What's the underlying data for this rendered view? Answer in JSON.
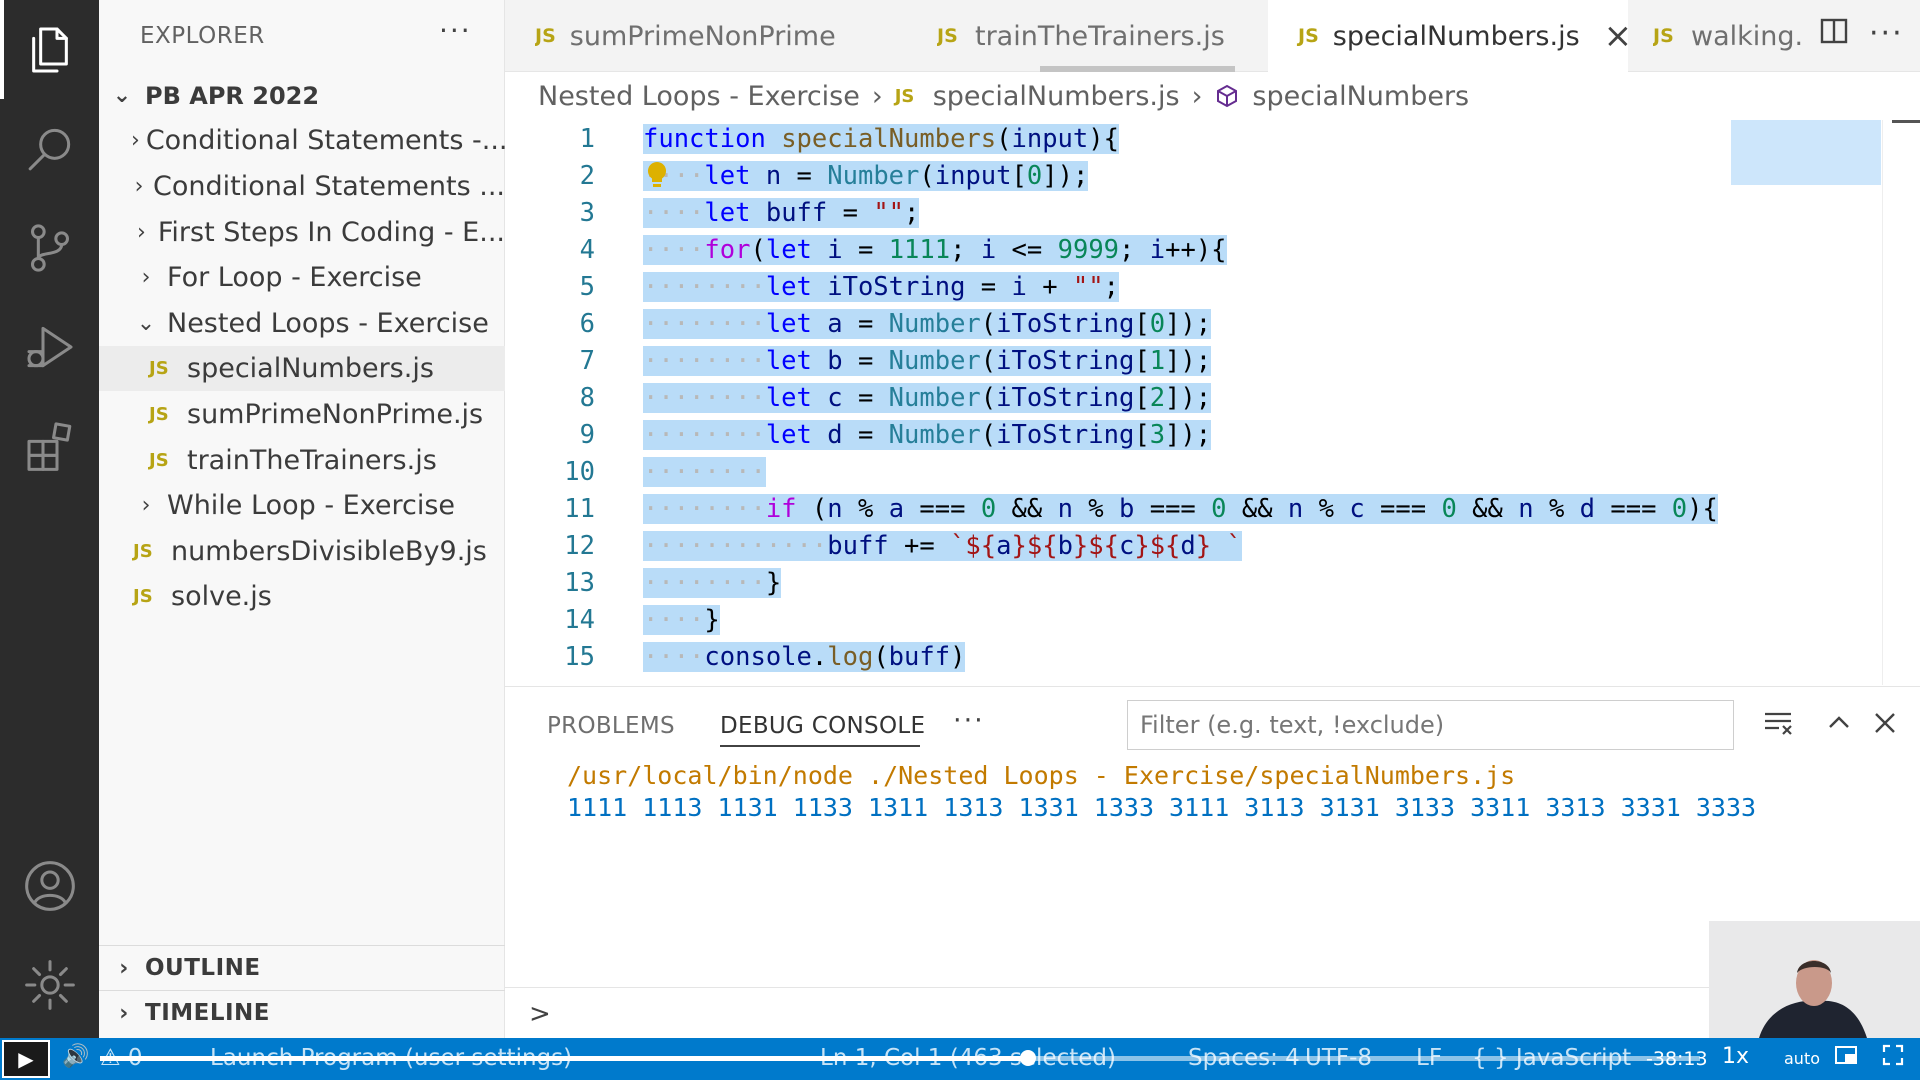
{
  "activity_bar": {
    "icons": [
      "explorer-icon",
      "search-icon",
      "source-control-icon",
      "run-debug-icon",
      "extensions-icon",
      "account-icon",
      "gear-icon"
    ]
  },
  "sidebar": {
    "title": "EXPLORER",
    "more": "···",
    "root": "PB APR 2022",
    "items": [
      {
        "label": "Conditional Statements -...",
        "type": "folder",
        "expanded": false
      },
      {
        "label": "Conditional Statements ...",
        "type": "folder",
        "expanded": false
      },
      {
        "label": "First Steps In Coding - E...",
        "type": "folder",
        "expanded": false
      },
      {
        "label": "For Loop - Exercise",
        "type": "folder",
        "expanded": false
      },
      {
        "label": "Nested Loops - Exercise",
        "type": "folder",
        "expanded": true
      },
      {
        "label": "specialNumbers.js",
        "type": "file",
        "selected": true
      },
      {
        "label": "sumPrimeNonPrime.js",
        "type": "file"
      },
      {
        "label": "trainTheTrainers.js",
        "type": "file"
      },
      {
        "label": "While Loop - Exercise",
        "type": "folder",
        "expanded": false
      },
      {
        "label": "numbersDivisibleBy9.js",
        "type": "file"
      },
      {
        "label": "solve.js",
        "type": "file"
      }
    ],
    "sections": [
      "OUTLINE",
      "TIMELINE"
    ]
  },
  "tabs": [
    {
      "label": "sumPrimeNonPrime.js",
      "badge": "JS"
    },
    {
      "label": "trainTheTrainers.js",
      "badge": "JS"
    },
    {
      "label": "specialNumbers.js",
      "badge": "JS",
      "active": true,
      "close": "×"
    },
    {
      "label": "walking.",
      "badge": "JS"
    }
  ],
  "breadcrumb": {
    "folder": "Nested Loops - Exercise",
    "file": "specialNumbers.js",
    "symbol": "specialNumbers",
    "badge": "JS"
  },
  "editor": {
    "line_numbers": [
      "1",
      "2",
      "3",
      "4",
      "5",
      "6",
      "7",
      "8",
      "9",
      "10",
      "11",
      "12",
      "13",
      "14",
      "15"
    ]
  },
  "panel": {
    "tabs": [
      "PROBLEMS",
      "DEBUG CONSOLE"
    ],
    "active_tab": "DEBUG CONSOLE",
    "more": "···",
    "filter_placeholder": "Filter (e.g. text, !exclude)",
    "console_command": "/usr/local/bin/node ./Nested Loops - Exercise/specialNumbers.js",
    "console_output": "1111 1113 1131 1133 1311 1313 1331 1333 3111 3113 3131 3133 3311 3313 3331 3333",
    "prompt": ">"
  },
  "status_bar": {
    "problems": "⚠ 0",
    "launch": "Launch Program (user settings)",
    "cursor": "Ln 1, Col 1 (463 selected)",
    "spaces": "Spaces: 4",
    "encoding": "UTF-8",
    "eol": "LF",
    "language": "{ } JavaScript",
    "time_remaining": "-38:13",
    "speed": "1x",
    "quality": "auto",
    "progress_fraction": 0.58
  },
  "colors": {
    "status_bar": "#007acc",
    "selection": "#b9dcf8",
    "js_badge": "#b7a415",
    "activity_bar": "#2c2c2c"
  }
}
